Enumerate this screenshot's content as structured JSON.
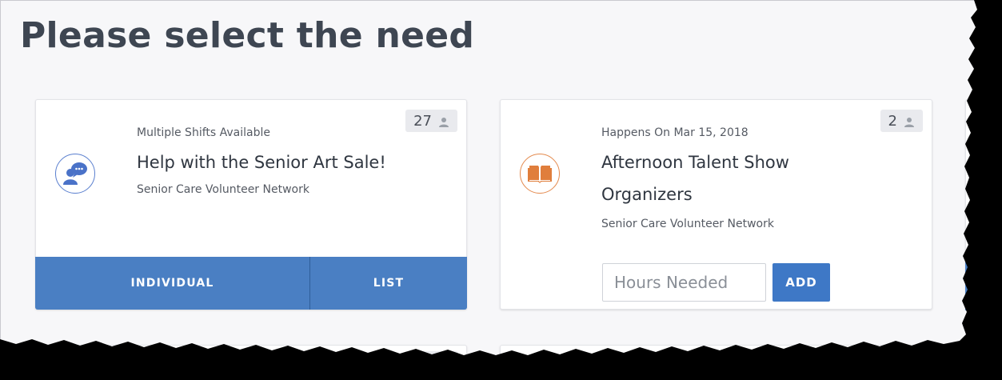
{
  "page": {
    "title": "Please select the need"
  },
  "needs": [
    {
      "schedule": "Multiple Shifts Available",
      "title": "Help with the Senior Art Sale!",
      "organization": "Senior Care Volunteer Network",
      "volunteer_count": "27",
      "icon": "chat-person-icon",
      "icon_color": "#5a7fcf",
      "actions": {
        "individual_label": "INDIVIDUAL",
        "list_label": "LIST"
      }
    },
    {
      "schedule": "Happens On Mar 15, 2018",
      "title": "Afternoon Talent Show Organizers",
      "organization": "Senior Care Volunteer Network",
      "volunteer_count": "2",
      "icon": "book-icon",
      "icon_color": "#e48a4e",
      "hours_input": {
        "placeholder": "Hours Needed",
        "value": ""
      },
      "add_label": "ADD"
    }
  ],
  "colors": {
    "primary_button": "#4a7fc3",
    "badge_bg": "#e9eaee",
    "page_bg": "#f7f7f9"
  }
}
